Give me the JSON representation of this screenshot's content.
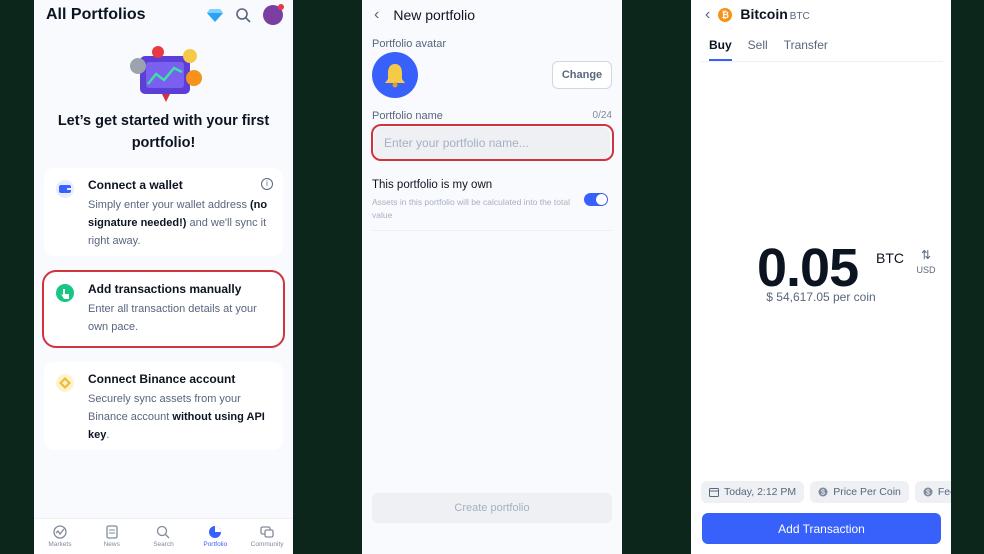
{
  "portfolios": {
    "title": "All Portfolios",
    "heading": "Let’s get started with your first portfolio!",
    "cards": [
      {
        "title": "Connect a wallet",
        "desc_parts": [
          "Simply enter your wallet address ",
          "(no signature needed!)",
          " and we'll sync it right away."
        ],
        "highlighted": false
      },
      {
        "title": "Add transactions manually",
        "desc_parts": [
          "Enter all transaction details at your own pace.",
          "",
          ""
        ],
        "highlighted": true
      },
      {
        "title": "Connect Binance account",
        "desc_parts": [
          "Securely sync assets from your Binance account ",
          "without using API key",
          "."
        ],
        "highlighted": false
      }
    ],
    "tabs": [
      {
        "label": "Markets",
        "active": false
      },
      {
        "label": "News",
        "active": false
      },
      {
        "label": "Search",
        "active": false
      },
      {
        "label": "Portfolio",
        "active": true
      },
      {
        "label": "Community",
        "active": false
      }
    ],
    "colors": {
      "highlight": "#d0343d",
      "accent": "#3861fb"
    }
  },
  "new_portfolio": {
    "title": "New portfolio",
    "avatar_label": "Portfolio avatar",
    "change_label": "Change",
    "name_label": "Portfolio name",
    "name_counter": "0/24",
    "name_placeholder": "Enter your portfolio name...",
    "name_value": "",
    "own_title": "This portfolio is my own",
    "own_desc": "Assets in this portfolio will be calculated into the total value",
    "own_toggle_on": true,
    "create_label": "Create portfolio"
  },
  "transaction": {
    "coin_name": "Bitcoin",
    "coin_symbol": "BTC",
    "tabs": [
      {
        "label": "Buy",
        "active": true
      },
      {
        "label": "Sell",
        "active": false
      },
      {
        "label": "Transfer",
        "active": false
      }
    ],
    "amount": "0.05",
    "amount_unit": "BTC",
    "swap_unit": "USD",
    "per_coin": "$ 54,617.05 per coin",
    "chips": [
      {
        "icon": "calendar-icon",
        "label": "Today, 2:12 PM"
      },
      {
        "icon": "dollar-circle-icon",
        "label": "Price Per Coin"
      },
      {
        "icon": "dollar-circle-icon",
        "label": "Fee"
      }
    ],
    "add_label": "Add Transaction"
  }
}
